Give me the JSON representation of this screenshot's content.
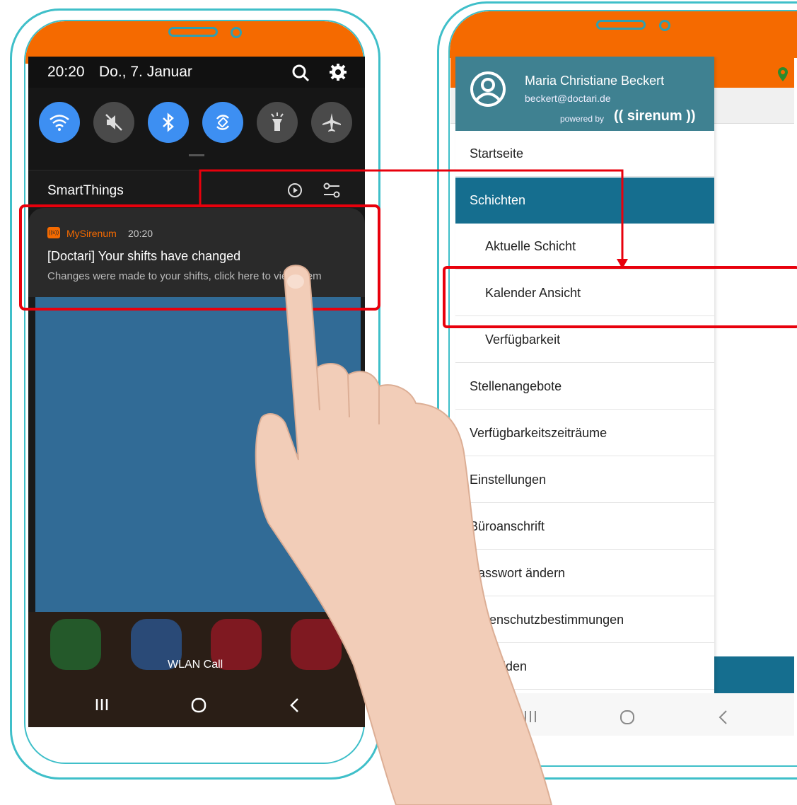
{
  "left_phone": {
    "status_bar": {
      "time": "20:20",
      "date": "Do., 7. Januar"
    },
    "quick_settings": [
      {
        "name": "wifi",
        "state": "on"
      },
      {
        "name": "sound-muted",
        "state": "off"
      },
      {
        "name": "bluetooth",
        "state": "on"
      },
      {
        "name": "auto-rotate",
        "state": "on"
      },
      {
        "name": "flashlight",
        "state": "off"
      },
      {
        "name": "airplane-mode",
        "state": "off"
      }
    ],
    "smartthings_label": "SmartThings",
    "notification": {
      "app_name": "MySirenum",
      "app_icon_text": "((s))",
      "time": "20:20",
      "title": "[Doctari] Your shifts have changed",
      "body": "Changes were made to your shifts, click here to view them"
    },
    "home_label": "WLAN Call"
  },
  "right_phone": {
    "user_name": "Maria Christiane Beckert",
    "user_email": "beckert@doctari.de",
    "powered_by": "powered by",
    "brand": "(( sirenum ))",
    "menu": [
      {
        "label": "Startseite",
        "level": 0,
        "active": false
      },
      {
        "label": "Schichten",
        "level": 0,
        "active": true
      },
      {
        "label": "Aktuelle Schicht",
        "level": 1,
        "active": false
      },
      {
        "label": "Kalender Ansicht",
        "level": 1,
        "active": false
      },
      {
        "label": "Verfügbarkeit",
        "level": 1,
        "active": false
      },
      {
        "label": "Stellenangebote",
        "level": 0,
        "active": false
      },
      {
        "label": "Verfügbarkeitszeiträume",
        "level": 0,
        "active": false
      },
      {
        "label": "Einstellungen",
        "level": 0,
        "active": false
      },
      {
        "label": "Büroanschrift",
        "level": 0,
        "active": false
      },
      {
        "label": "Passwort ändern",
        "level": 0,
        "active": false
      },
      {
        "label": "Datenschutzbestimmungen",
        "level": 0,
        "active": false
      },
      {
        "label": "Abmelden",
        "level": 0,
        "active": false
      }
    ]
  },
  "colors": {
    "frame": "#3fbfc9",
    "accent_orange": "#f56a00",
    "header_teal": "#3f8191",
    "active_blue": "#156e8f",
    "highlight_red": "#e8000c",
    "toggle_blue": "#3d8ff2"
  }
}
